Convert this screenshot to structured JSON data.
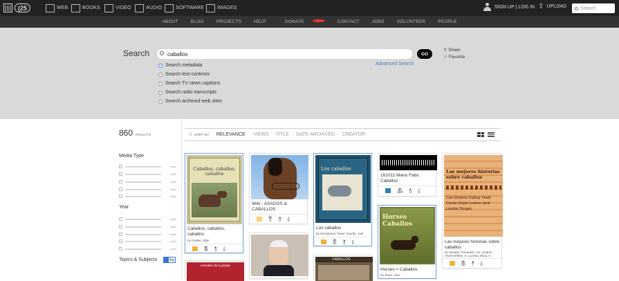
{
  "topbar": {
    "logo": "(25",
    "nav": [
      "WEB",
      "BOOKS",
      "VIDEO",
      "AUDIO",
      "SOFTWARE",
      "IMAGES"
    ],
    "nav_icons": [
      "web-icon",
      "books-icon",
      "video-icon",
      "audio-icon",
      "software-icon",
      "images-icon"
    ],
    "signup": "SIGN UP | LOG IN",
    "upload": "UPLOAD",
    "search_placeholder": "Search"
  },
  "subnav": [
    "ABOUT",
    "BLOG",
    "PROJECTS",
    "HELP",
    "DONATE",
    "CONTACT",
    "JOBS",
    "VOLUNTEER",
    "PEOPLE"
  ],
  "search": {
    "title": "Search",
    "query": "caballos",
    "go": "GO",
    "share": "Share",
    "favorite": "Favorite",
    "advanced": "Advanced Search",
    "options": [
      "Search metadata",
      "Search text contents",
      "Search TV news captions",
      "Search radio transcripts",
      "Search archived web sites"
    ],
    "selected": 0
  },
  "sidebar": {
    "count": "860",
    "count_label": "RESULTS",
    "facets": [
      "Media Type",
      "Year",
      "Topics & Subjects"
    ],
    "topics_badge": "Aa"
  },
  "sort": {
    "label": "SORT BY",
    "options": [
      "RELEVANCE",
      "VIEWS",
      "TITLE",
      "DATE ARCHIVED",
      "CREATOR"
    ]
  },
  "colors": {
    "accent": "#4a78c5",
    "topbar": "#222222",
    "hero": "#d9d9d9"
  },
  "tiles": [
    {
      "title": "Caballos, caballos, caballos",
      "by": "by Fowler, Allan",
      "type": "book",
      "views": "46",
      "favs": "3",
      "reviews": "0"
    },
    {
      "title": "Wiki - ASADOS & CABALLOS",
      "by": "",
      "type": "folder",
      "views": "0",
      "favs": "0",
      "reviews": "0"
    },
    {
      "title": "Los caballos",
      "by": "by Greydanus, Rose; Snyder, Joel",
      "type": "book",
      "views": "41",
      "favs": "0",
      "reviews": "0"
    },
    {
      "title": "161011 Mario Fabo Caballos",
      "by": "",
      "type": "audio",
      "views": "354",
      "favs": "0",
      "reviews": "0"
    },
    {
      "title": "Horses = Caballos",
      "by": "by Teme, Alice",
      "type": "book",
      "views": "",
      "favs": "",
      "reviews": ""
    },
    {
      "title": "Las mejores historias sobre caballos",
      "by": "by Savater, Fernando, ed.; Suárez, Anna-Hélène, tr; Lucena, Elisa, tr",
      "type": "book",
      "views": "50",
      "favs": "7",
      "reviews": "0"
    }
  ],
  "cover_text": {
    "c1_title": "Caballos, caballos, caballos",
    "c3_title": "Los caballos",
    "c5_title": "Horses Caballos",
    "c6_title": "Las mejores historias sobre caballos",
    "c6_authors": "Carl Dickens Kipling Twain Conan Doyle Leskov Jack London Borges",
    "c7_title": "CABALLOS",
    "c9_title": "Animales de la granja"
  }
}
